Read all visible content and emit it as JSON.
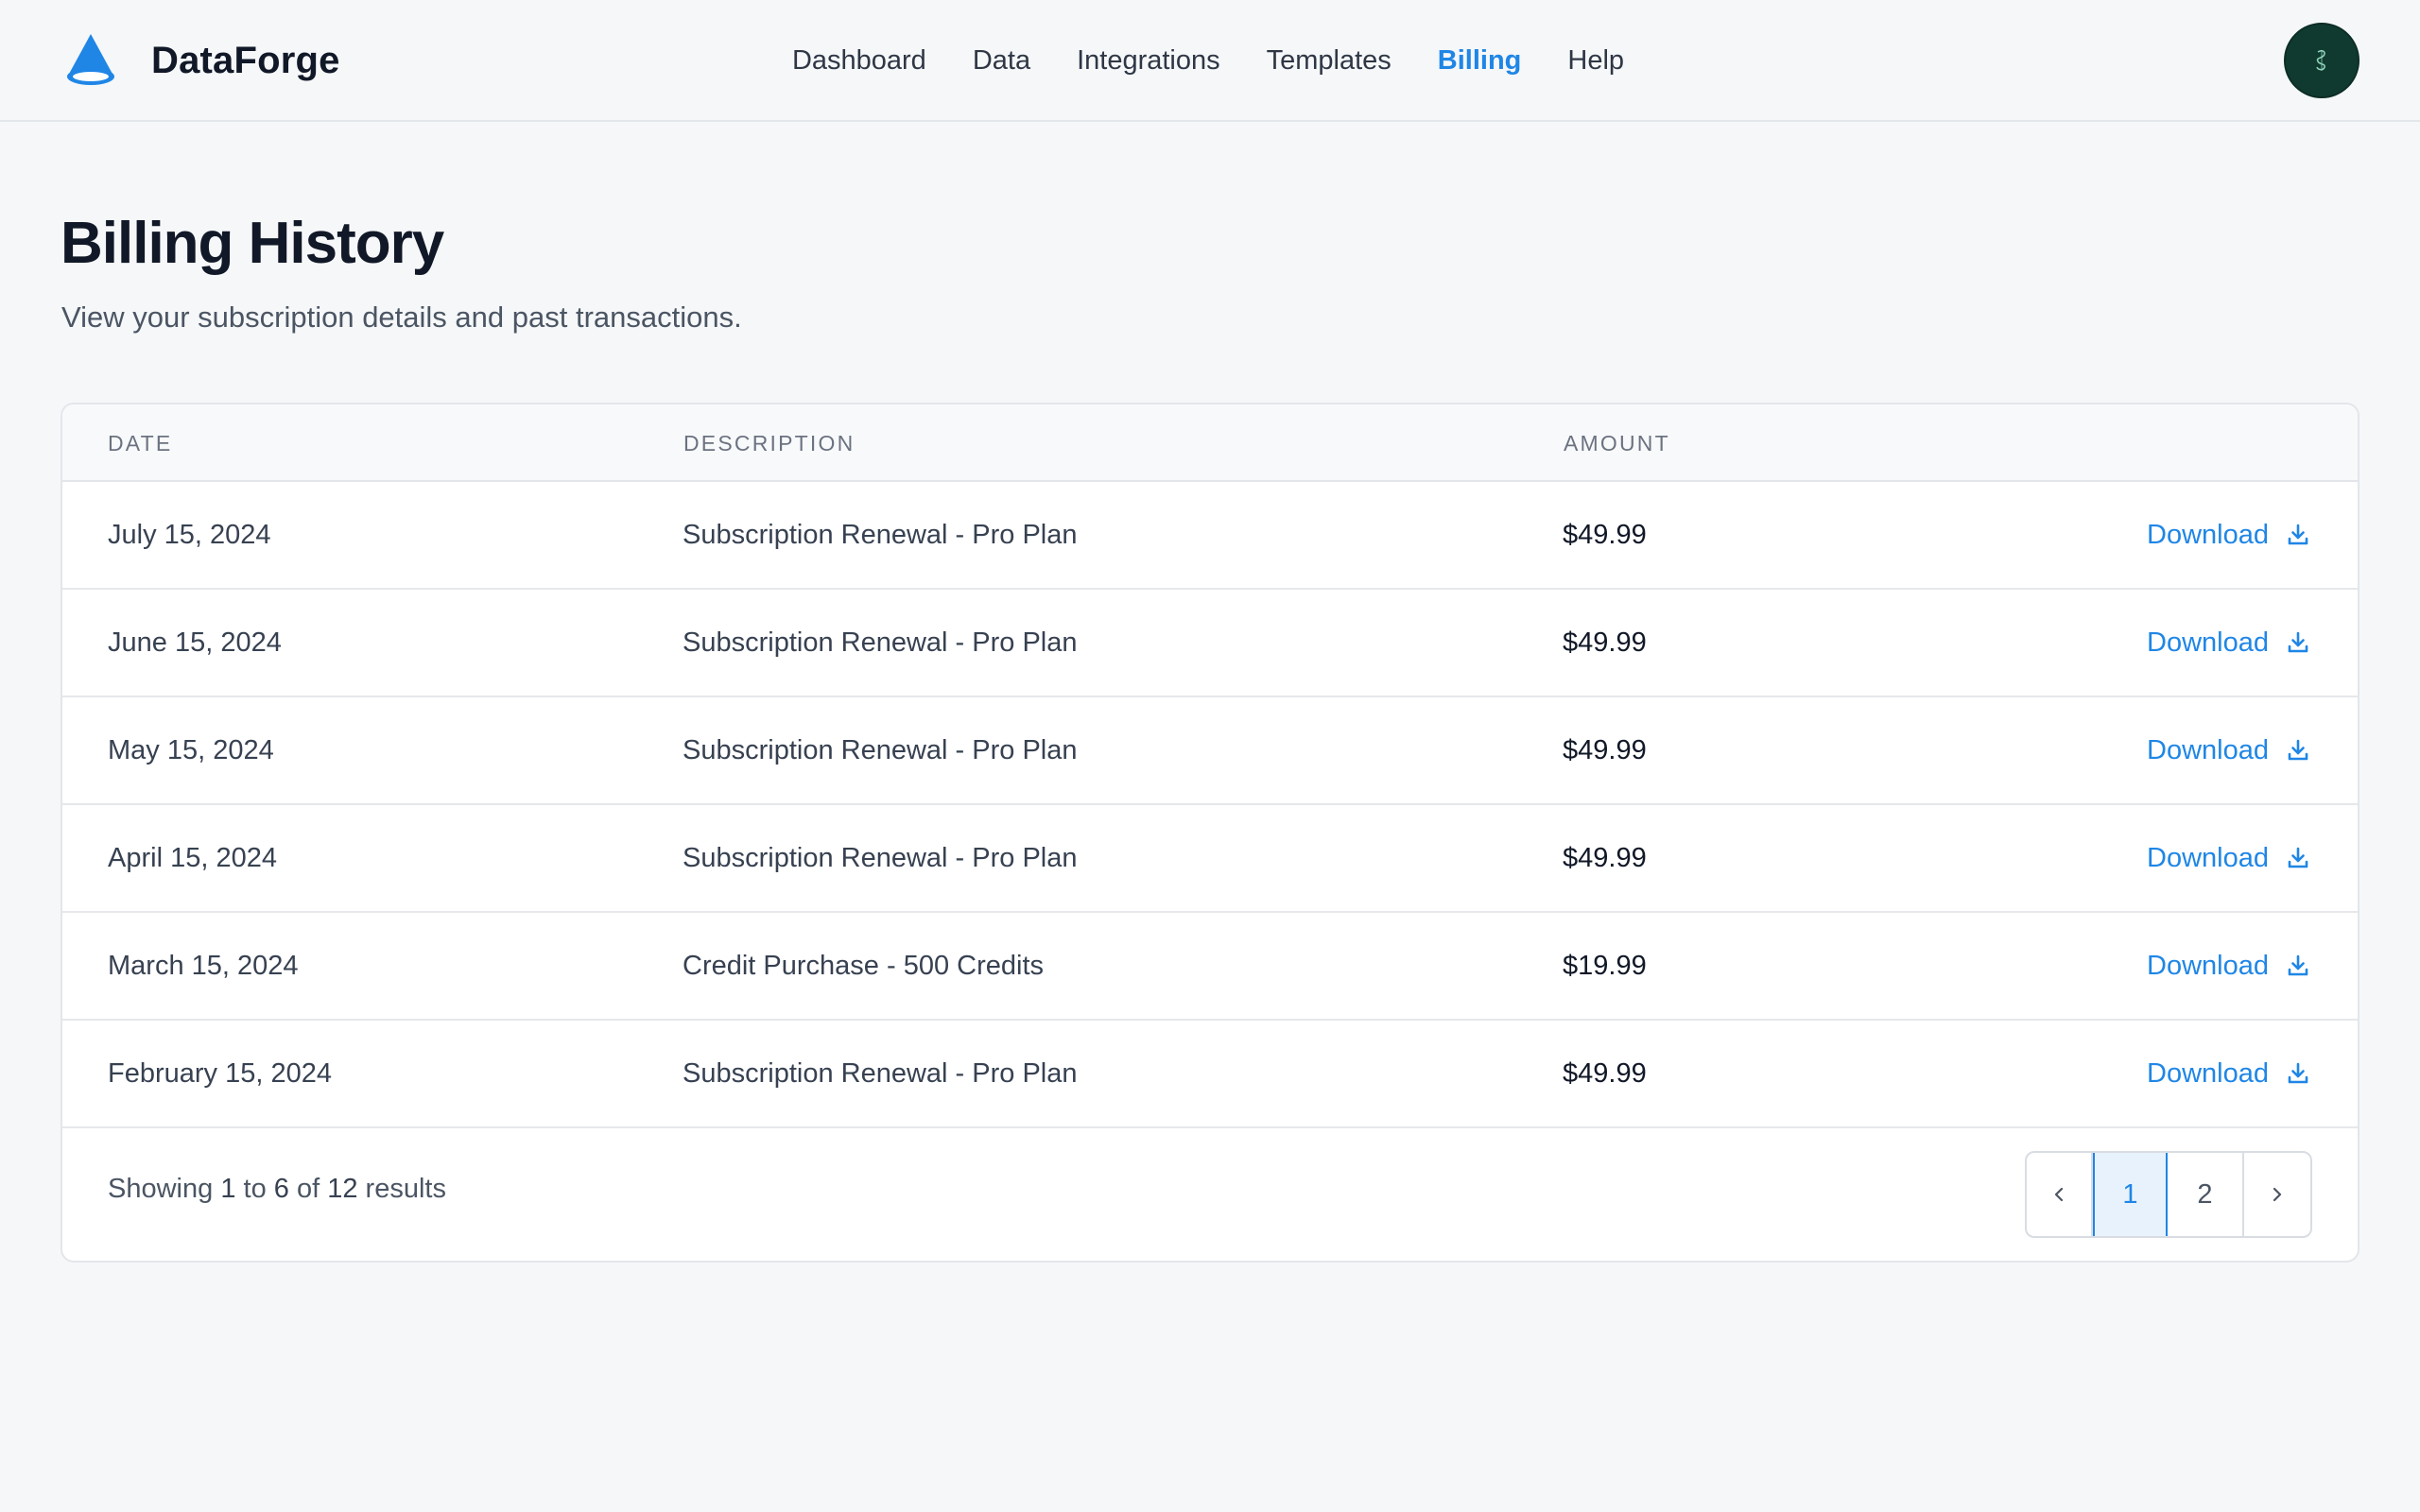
{
  "app": {
    "name": "DataForge"
  },
  "nav": {
    "items": [
      {
        "label": "Dashboard",
        "active": false
      },
      {
        "label": "Data",
        "active": false
      },
      {
        "label": "Integrations",
        "active": false
      },
      {
        "label": "Templates",
        "active": false
      },
      {
        "label": "Billing",
        "active": true
      },
      {
        "label": "Help",
        "active": false
      }
    ]
  },
  "user": {
    "avatar_icon": "brand-mark-icon"
  },
  "page": {
    "title": "Billing History",
    "subtitle": "View your subscription details and past transactions."
  },
  "table": {
    "headers": {
      "date": "DATE",
      "description": "DESCRIPTION",
      "amount": "AMOUNT"
    },
    "rows": [
      {
        "date": "July 15, 2024",
        "description": "Subscription Renewal - Pro Plan",
        "amount": "$49.99",
        "action": "Download"
      },
      {
        "date": "June 15, 2024",
        "description": "Subscription Renewal - Pro Plan",
        "amount": "$49.99",
        "action": "Download"
      },
      {
        "date": "May 15, 2024",
        "description": "Subscription Renewal - Pro Plan",
        "amount": "$49.99",
        "action": "Download"
      },
      {
        "date": "April 15, 2024",
        "description": "Subscription Renewal - Pro Plan",
        "amount": "$49.99",
        "action": "Download"
      },
      {
        "date": "March 15, 2024",
        "description": "Credit Purchase - 500 Credits",
        "amount": "$19.99",
        "action": "Download"
      },
      {
        "date": "February 15, 2024",
        "description": "Subscription Renewal - Pro Plan",
        "amount": "$49.99",
        "action": "Download"
      }
    ]
  },
  "pagination": {
    "showing_prefix": "Showing",
    "from": "1",
    "to_word": "to",
    "to": "6",
    "of_word": "of",
    "total": "12",
    "suffix": "results",
    "pages": [
      "1",
      "2"
    ],
    "current_page": "1"
  },
  "colors": {
    "accent": "#1f86e6",
    "background": "#f5f7f9",
    "avatar_bg": "#103a2f"
  },
  "icons": {
    "logo": "cone-logo-icon",
    "download": "download-icon",
    "prev": "chevron-left-icon",
    "next": "chevron-right-icon"
  }
}
